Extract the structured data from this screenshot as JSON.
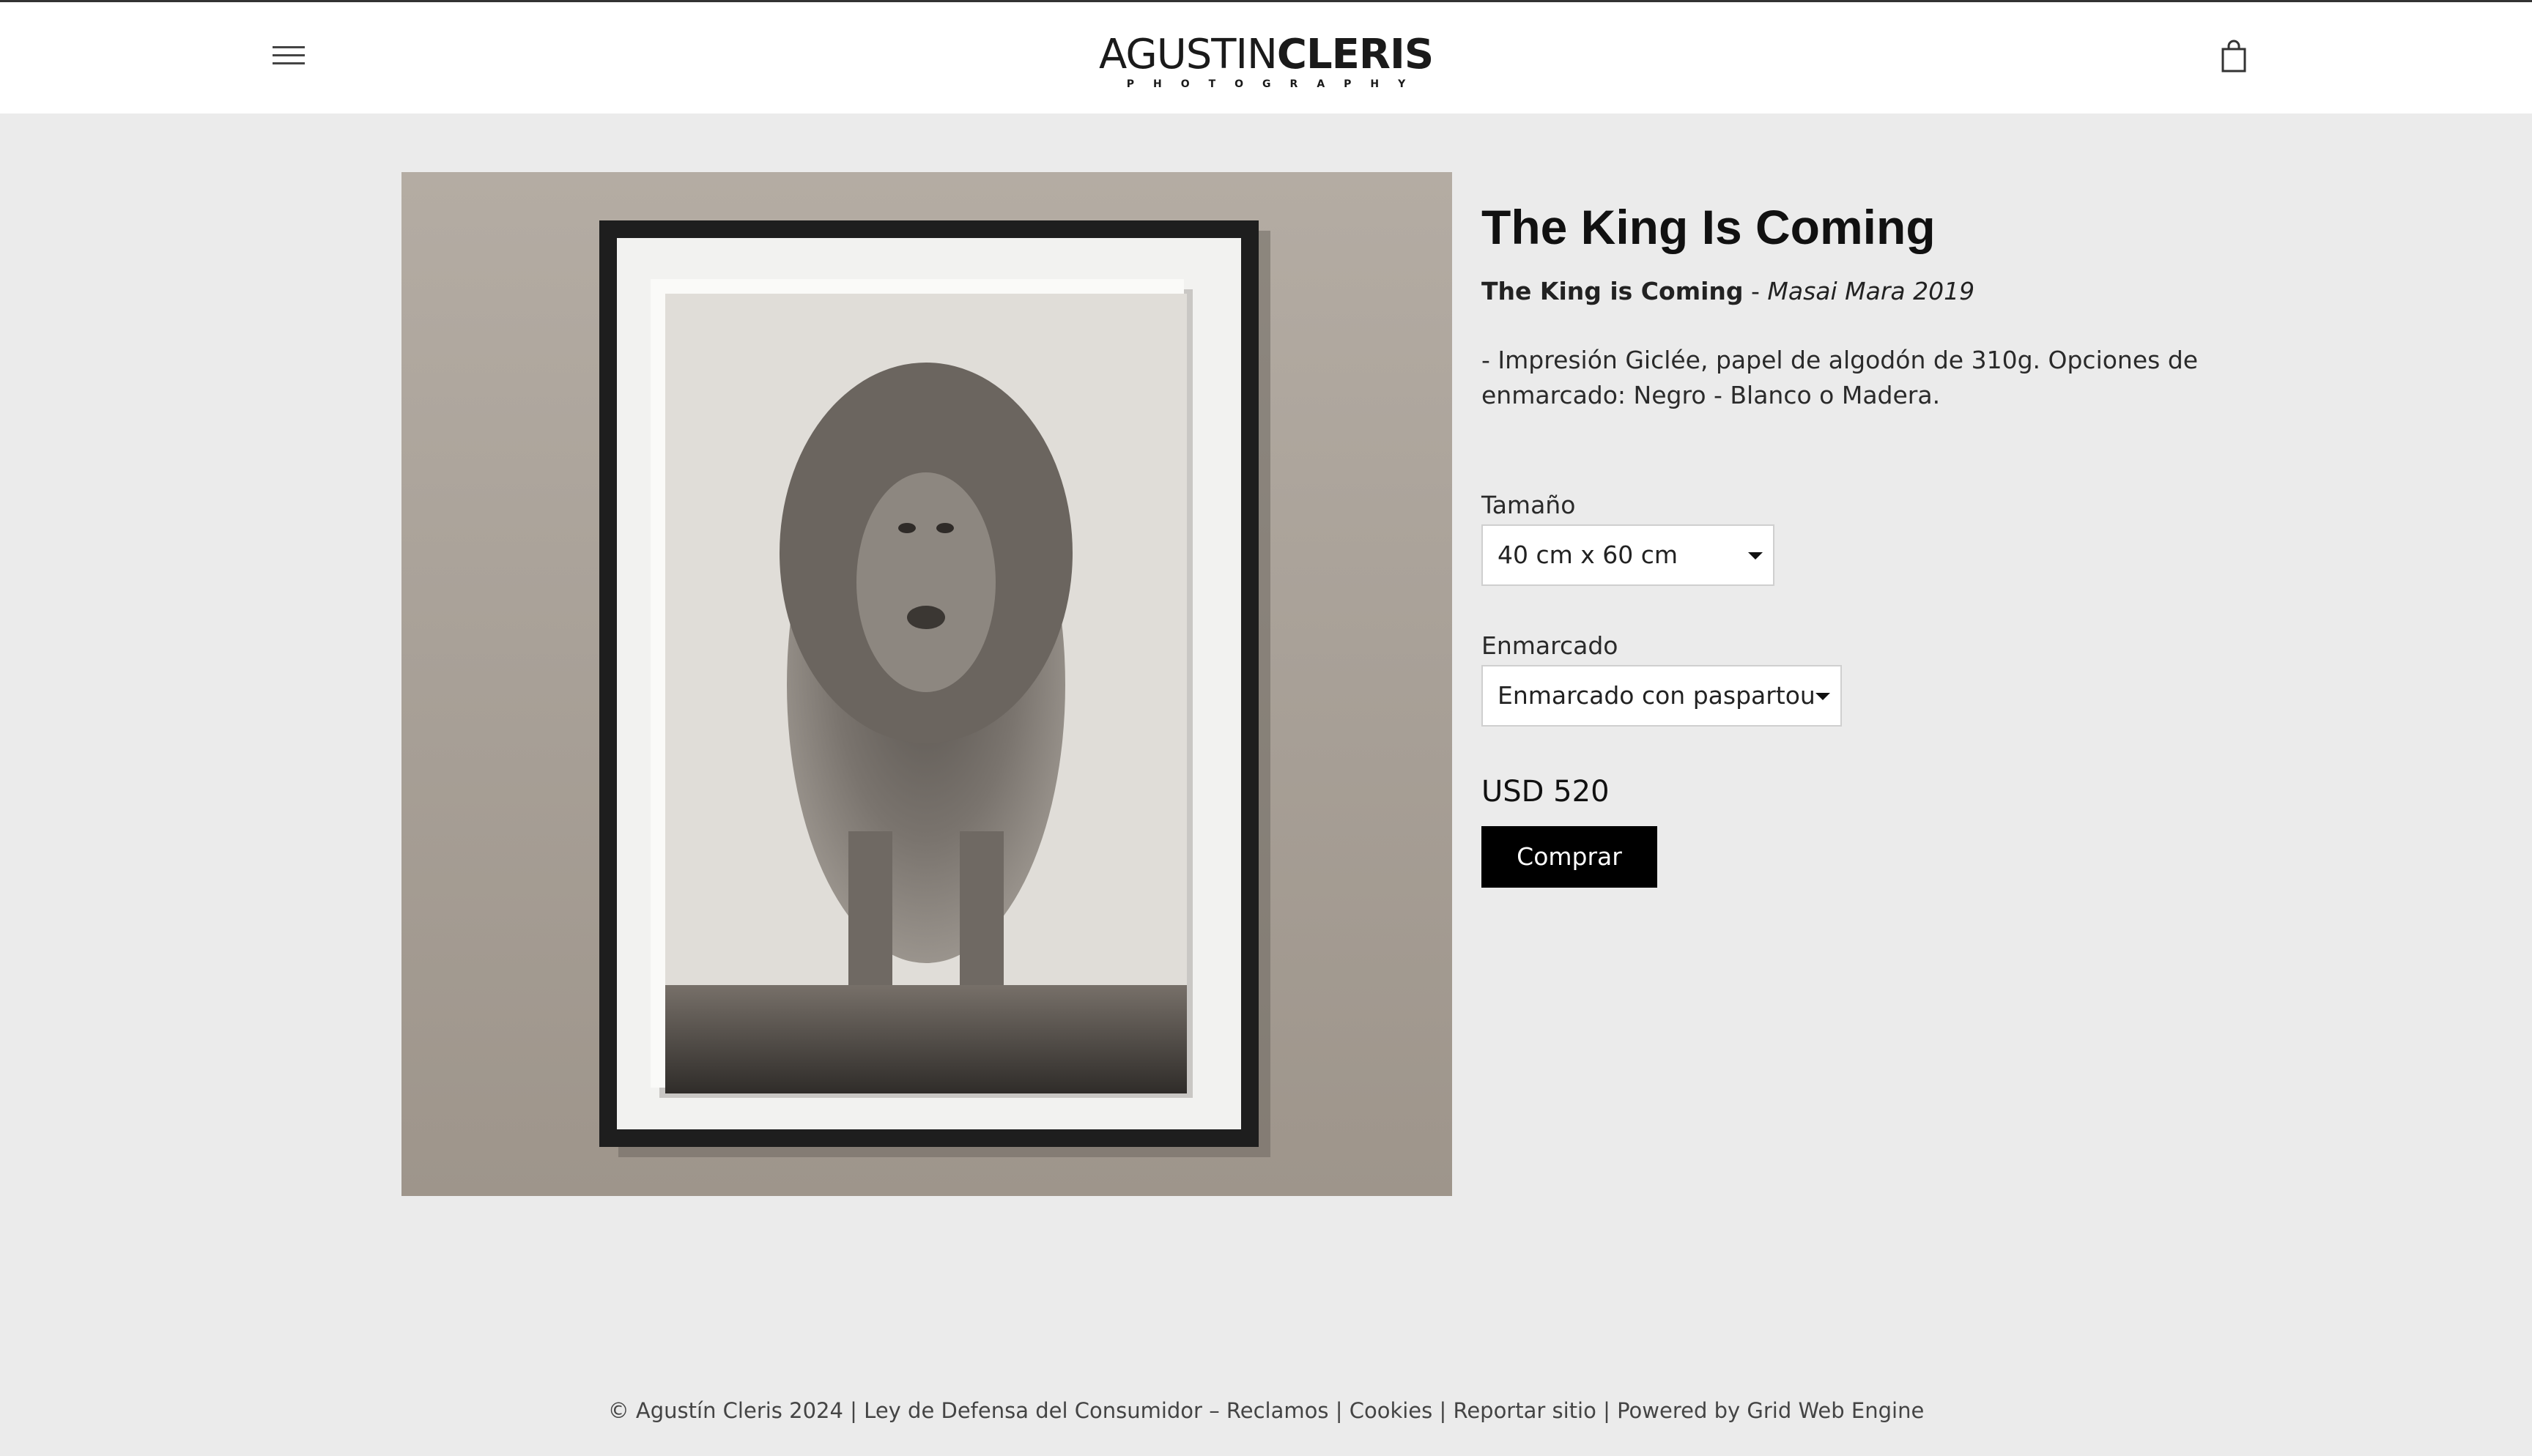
{
  "header": {
    "menu_icon": "hamburger-menu-icon",
    "logo_thin": "AGUSTIN",
    "logo_bold": "CLERIS",
    "logo_sub": "PHOTOGRAPHY",
    "cart_icon": "shopping-bag-icon"
  },
  "product": {
    "image_icon": "framed-lion-photograph",
    "title": "The King Is Coming",
    "subtitle_bold": "The King is Coming",
    "subtitle_sep": " - ",
    "subtitle_italic": "Masai Mara 2019",
    "description": "- Impresión Giclée, papel de algodón de 310g. Opciones de enmarcado: Negro - Blanco o Madera.",
    "size_label": "Tamaño",
    "size_value": "40 cm x 60 cm",
    "frame_label": "Enmarcado",
    "frame_value": "Enmarcado con paspartou",
    "price": "USD 520",
    "buy_label": "Comprar"
  },
  "footer": {
    "copyright": "© Agustín Cleris 2024",
    "sep": " | ",
    "link_consumer": "Ley de Defensa del Consumidor – Reclamos",
    "link_cookies": "Cookies",
    "link_report": "Reportar sitio",
    "link_powered": "Powered by Grid Web Engine"
  }
}
